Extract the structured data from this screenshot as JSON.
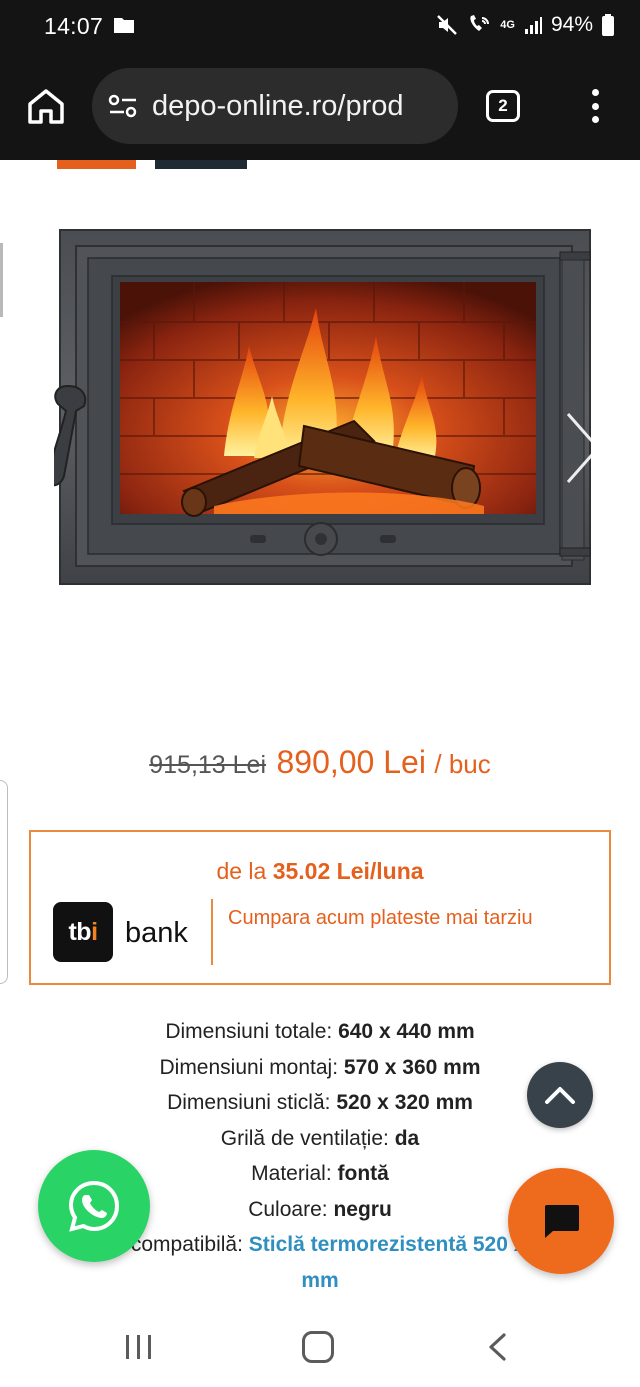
{
  "status_bar": {
    "time": "14:07",
    "battery": "94%",
    "network": "4G",
    "icons": [
      "folder-icon",
      "mute-icon",
      "wifi-calling-icon",
      "signal-icon",
      "battery-icon"
    ]
  },
  "browser": {
    "url": "depo-online.ro/prod",
    "tab_count": "2",
    "icons": [
      "home-icon",
      "site-settings-icon",
      "tab-switcher-icon",
      "more-menu-icon"
    ]
  },
  "product": {
    "image_alt": "Usa semineu fonta cu geam",
    "old_price": "915,13 Lei",
    "price": "890,00 Lei",
    "unit": "/ buc"
  },
  "tbi": {
    "from_prefix": "de la",
    "installment": "35.02 Lei/luna",
    "logo_tb": "tb",
    "logo_i": "i",
    "bank_word": "bank",
    "cta": "Cumpara acum plateste mai tarziu"
  },
  "specs": [
    {
      "label": "Dimensiuni totale:",
      "value": "640 x 440 mm"
    },
    {
      "label": "Dimensiuni montaj:",
      "value": "570 x 360 mm"
    },
    {
      "label": "Dimensiuni sticlă:",
      "value": "520 x 320 mm"
    },
    {
      "label": "Grilă de ventilație:",
      "value": "da"
    },
    {
      "label": "Material:",
      "value": "fontă"
    },
    {
      "label": "Culoare:",
      "value": "negru"
    },
    {
      "label": "Sticlă compatibilă:",
      "value": "Sticlă termorezistentă 520 x 320 mm"
    }
  ],
  "colors": {
    "accent": "#e5601c",
    "link": "#2f8fc0",
    "whatsapp": "#29d366",
    "dark": "#37424a"
  }
}
